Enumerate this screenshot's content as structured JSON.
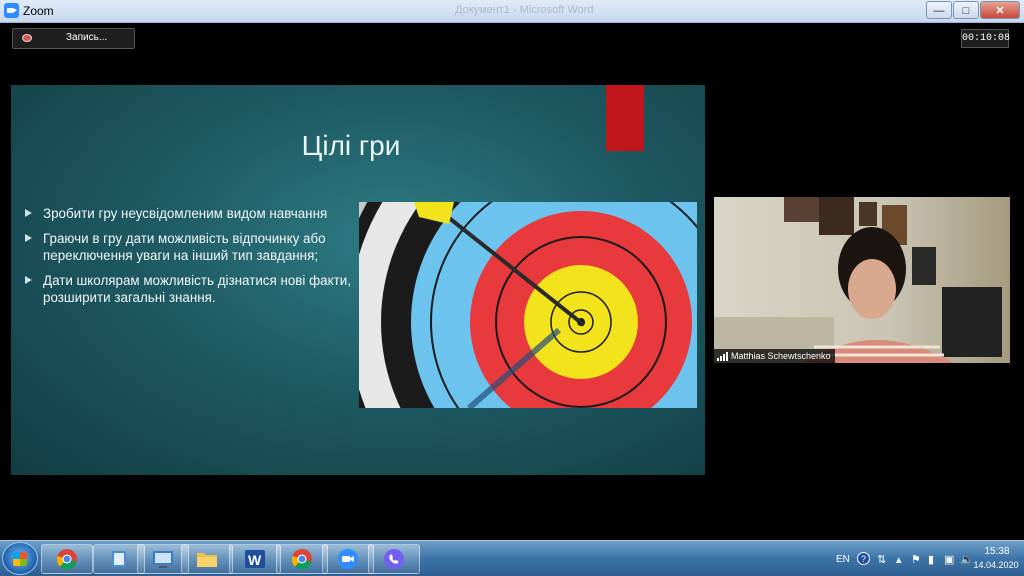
{
  "window": {
    "title": "Zoom",
    "faded_title": "Документ1 - Microsoft Word"
  },
  "recording": {
    "label": "Запись..."
  },
  "meeting": {
    "timer": "00:10:08"
  },
  "slide": {
    "title": "Цілі гри",
    "bullets": [
      "Зробити гру неусвідомленим видом навчання",
      "Граючи в гру дати можливість відпочинку або переключення уваги на інший тип завдання;",
      "Дати школярам можливість дізнатися нові факти, розширити загальні знання."
    ],
    "accent_color": "#c0161b"
  },
  "participant": {
    "name": "Matthias Schewtschenko"
  },
  "taskbar": {
    "items": [
      "start-button",
      "chrome",
      "file-explorer",
      "control-panel",
      "folder",
      "word",
      "chrome-2",
      "zoom",
      "viber"
    ]
  },
  "tray": {
    "language": "EN",
    "time": "15:38",
    "date": "14.04.2020"
  }
}
